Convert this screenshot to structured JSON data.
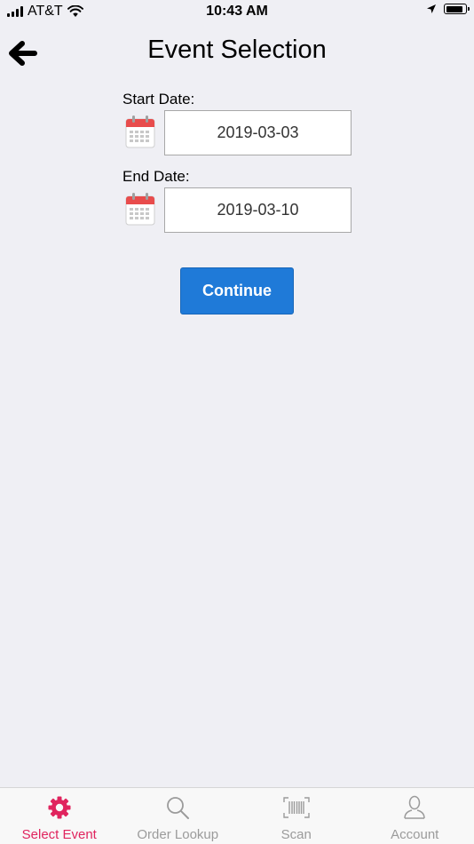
{
  "status_bar": {
    "carrier": "AT&T",
    "time": "10:43 AM",
    "battery_level": 0.9
  },
  "header": {
    "title": "Event Selection"
  },
  "form": {
    "start_date_label": "Start Date:",
    "start_date_value": "2019-03-03",
    "end_date_label": "End Date:",
    "end_date_value": "2019-03-10",
    "continue_label": "Continue"
  },
  "tab_bar": {
    "active_color": "#e0245e",
    "inactive_color": "#9b9b9b",
    "items": [
      {
        "label": "Select Event",
        "icon": "gear-icon",
        "active": true
      },
      {
        "label": "Order Lookup",
        "icon": "search-icon",
        "active": false
      },
      {
        "label": "Scan",
        "icon": "barcode-icon",
        "active": false
      },
      {
        "label": "Account",
        "icon": "user-icon",
        "active": false
      }
    ]
  },
  "colors": {
    "background": "#efeff4",
    "primary_button": "#1f7ad8",
    "calendar_red": "#e84c4c"
  }
}
